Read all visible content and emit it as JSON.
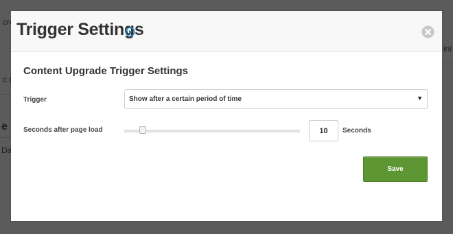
{
  "background": {
    "left_fragments": [
      "cre",
      "c t",
      "e",
      "Da"
    ],
    "right_fragment": "ini"
  },
  "modal": {
    "title": "Trigger Settings",
    "section_title": "Content Upgrade Trigger Settings",
    "trigger": {
      "label": "Trigger",
      "selected": "Show after a certain period of time",
      "caret": "▼"
    },
    "seconds": {
      "label": "Seconds after page load",
      "value": "10",
      "unit": "Seconds",
      "slider_fraction": 0.1
    },
    "save_label": "Save"
  },
  "colors": {
    "overlay": "#5b5b5b",
    "accent_blue": "#2a8fc7",
    "save_green": "#5e9633",
    "close_gray": "#c8c8c8"
  },
  "icons": {
    "video": "play-circle-icon",
    "close": "close-circle-icon"
  }
}
